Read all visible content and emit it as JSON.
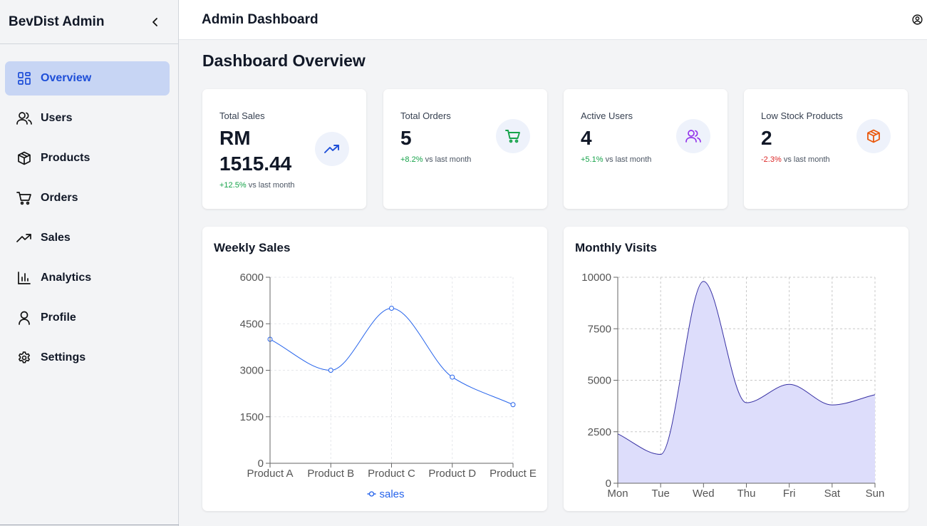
{
  "sidebar": {
    "brand": "BevDist Admin",
    "items": [
      {
        "label": "Overview",
        "icon": "grid-icon"
      },
      {
        "label": "Users",
        "icon": "users-icon"
      },
      {
        "label": "Products",
        "icon": "box-icon"
      },
      {
        "label": "Orders",
        "icon": "cart-icon"
      },
      {
        "label": "Sales",
        "icon": "trending-up-icon"
      },
      {
        "label": "Analytics",
        "icon": "bar-chart-icon"
      },
      {
        "label": "Profile",
        "icon": "user-icon"
      },
      {
        "label": "Settings",
        "icon": "gear-icon"
      }
    ],
    "active": "Overview"
  },
  "header": {
    "title": "Admin Dashboard"
  },
  "main": {
    "title": "Dashboard Overview",
    "stats": [
      {
        "label": "Total Sales",
        "value": "RM 1515.44",
        "change": "+12.5%",
        "change_suffix": "vs last month",
        "trend": "up",
        "icon": "trending-up-icon",
        "icon_color": "#1d4ed8"
      },
      {
        "label": "Total Orders",
        "value": "5",
        "change": "+8.2%",
        "change_suffix": "vs last month",
        "trend": "up",
        "icon": "cart-icon",
        "icon_color": "#16a34a"
      },
      {
        "label": "Active Users",
        "value": "4",
        "change": "+5.1%",
        "change_suffix": "vs last month",
        "trend": "up",
        "icon": "users-icon",
        "icon_color": "#9333ea"
      },
      {
        "label": "Low Stock Products",
        "value": "2",
        "change": "-2.3%",
        "change_suffix": "vs last month",
        "trend": "down",
        "icon": "box-icon",
        "icon_color": "#ea580c"
      }
    ]
  },
  "chart_data": [
    {
      "type": "line",
      "title": "Weekly Sales",
      "categories": [
        "Product A",
        "Product B",
        "Product C",
        "Product D",
        "Product E"
      ],
      "series": [
        {
          "name": "sales",
          "values": [
            4000,
            3000,
            5000,
            2780,
            1890
          ],
          "color": "#2563eb"
        }
      ],
      "ylim": [
        0,
        6000
      ],
      "yticks": [
        0,
        1500,
        3000,
        4500,
        6000
      ],
      "grid": true,
      "legend": "bottom"
    },
    {
      "type": "area",
      "title": "Monthly Visits",
      "categories": [
        "Mon",
        "Tue",
        "Wed",
        "Thu",
        "Fri",
        "Sat",
        "Sun"
      ],
      "series": [
        {
          "values": [
            2400,
            1400,
            9800,
            3908,
            4800,
            3800,
            4300
          ],
          "color": "#3730a3",
          "fill": "#ddddfb"
        }
      ],
      "ylim": [
        0,
        10000
      ],
      "yticks": [
        0,
        2500,
        5000,
        7500,
        10000
      ],
      "grid": true
    }
  ]
}
